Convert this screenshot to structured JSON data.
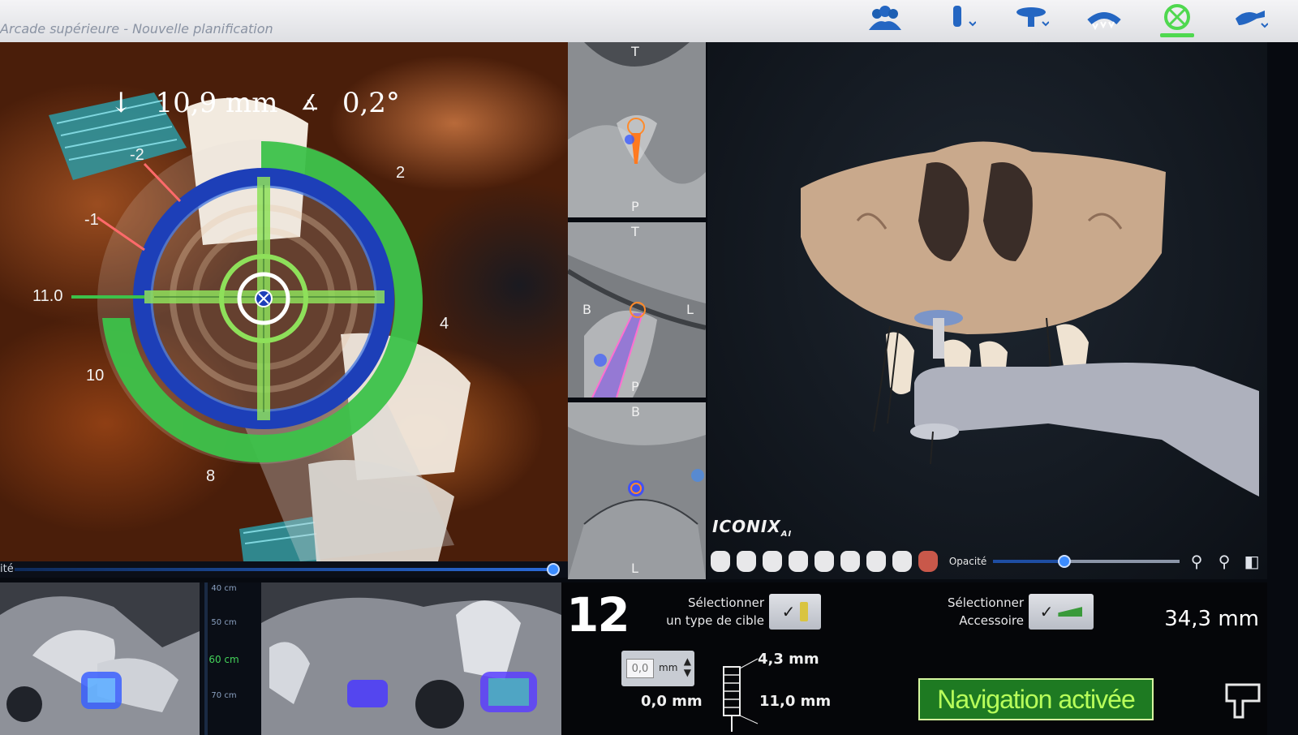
{
  "app": {
    "title": "Arcade supérieure - Nouvelle planification",
    "brand": "ICONIX",
    "brand_suffix": "AI",
    "accent": "#4fd84f"
  },
  "toolbar": {
    "items": [
      {
        "icon": "patients-icon"
      },
      {
        "icon": "drill-icon"
      },
      {
        "icon": "implant-platform-icon"
      },
      {
        "icon": "arch-icon"
      },
      {
        "icon": "navigation-target-icon",
        "active": true
      },
      {
        "icon": "handpiece-icon"
      }
    ]
  },
  "navigation": {
    "depth": "10,9 mm",
    "angle": "0,2°",
    "ring_labels": {
      "m2": "-2",
      "m1": "-1",
      "p2": "2",
      "p4": "4",
      "l11": "11.0",
      "l10": "10",
      "l8": "8"
    },
    "slider_label": "ité"
  },
  "ct_slices": [
    {
      "top": "T",
      "bottom": "P"
    },
    {
      "top": "T",
      "left": "B",
      "right": "L",
      "bottom": "P"
    },
    {
      "top": "B",
      "bottom": "L"
    }
  ],
  "model": {
    "opacity_label": "Opacité",
    "opacity_value": 0.38
  },
  "distance_scale": [
    "40 cm",
    "50 cm",
    "60 cm",
    "70 cm"
  ],
  "distance_active": "60 cm",
  "bottom": {
    "tooth_number": "12",
    "select_target": [
      "Sélectionner",
      "un type de cible"
    ],
    "select_accessory": [
      "Sélectionner",
      "Accessoire"
    ],
    "length": "34,3 mm",
    "stepper_value": "0,0",
    "stepper_unit": "mm",
    "dim_top": "4,3 mm",
    "dim_left": "0,0 mm",
    "dim_right": "11,0 mm",
    "nav_status": "Navigation activée"
  }
}
